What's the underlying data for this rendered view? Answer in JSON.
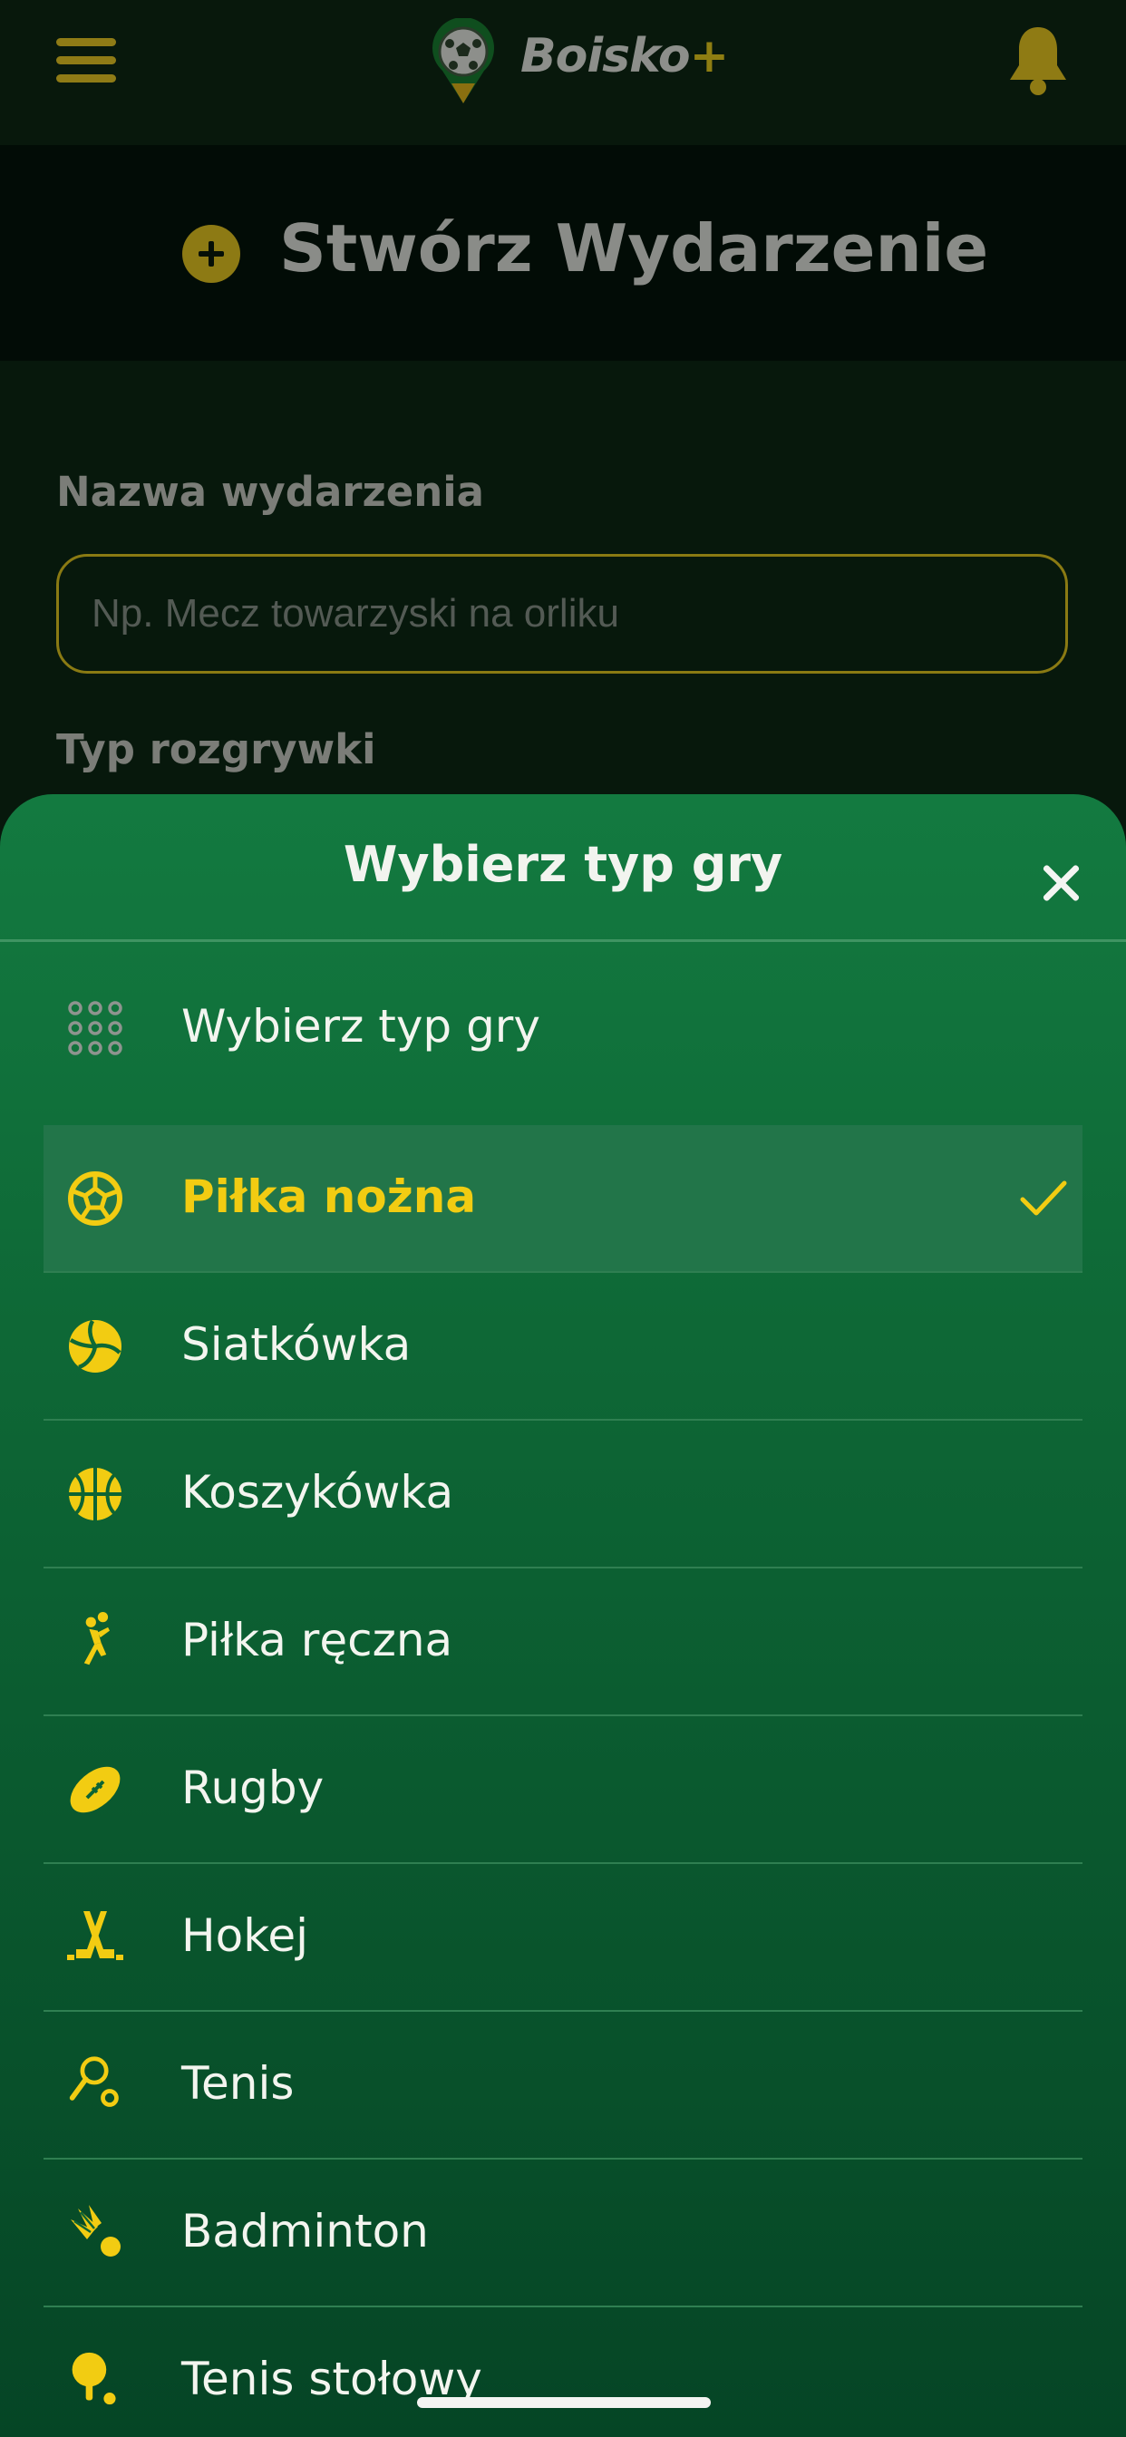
{
  "header": {
    "app_name": "Boisko",
    "app_name_suffix": "+",
    "icons": {
      "menu": "menu-icon",
      "notifications": "bell-icon",
      "logo": "soccer-ball-pin-logo"
    }
  },
  "page": {
    "title": "Stwórz Wydarzenie",
    "title_icon": "plus-circle-icon"
  },
  "form": {
    "event_name_label": "Nazwa wydarzenia",
    "event_name_placeholder": "Np. Mecz towarzyski na orliku",
    "event_name_value": "",
    "game_type_label": "Typ rozgrywki"
  },
  "sheet": {
    "title": "Wybierz typ gry",
    "close_icon": "close-icon",
    "options": [
      {
        "label": "Wybierz typ gry",
        "icon": "grid-dots-icon",
        "selected": false
      },
      {
        "label": "Piłka nożna",
        "icon": "soccer-ball-icon",
        "selected": true
      },
      {
        "label": "Siatkówka",
        "icon": "volleyball-icon",
        "selected": false
      },
      {
        "label": "Koszykówka",
        "icon": "basketball-icon",
        "selected": false
      },
      {
        "label": "Piłka ręczna",
        "icon": "handball-player-icon",
        "selected": false
      },
      {
        "label": "Rugby",
        "icon": "rugby-ball-icon",
        "selected": false
      },
      {
        "label": "Hokej",
        "icon": "hockey-sticks-icon",
        "selected": false
      },
      {
        "label": "Tenis",
        "icon": "tennis-racket-icon",
        "selected": false
      },
      {
        "label": "Badminton",
        "icon": "shuttlecock-icon",
        "selected": false
      },
      {
        "label": "Tenis stołowy",
        "icon": "table-tennis-icon",
        "selected": false
      }
    ]
  },
  "colors": {
    "accent_yellow": "#f2cc12",
    "sheet_green": "#137a40",
    "selected_row": "#227549",
    "dim_accent": "#8d7a14",
    "background": "#07180c"
  }
}
